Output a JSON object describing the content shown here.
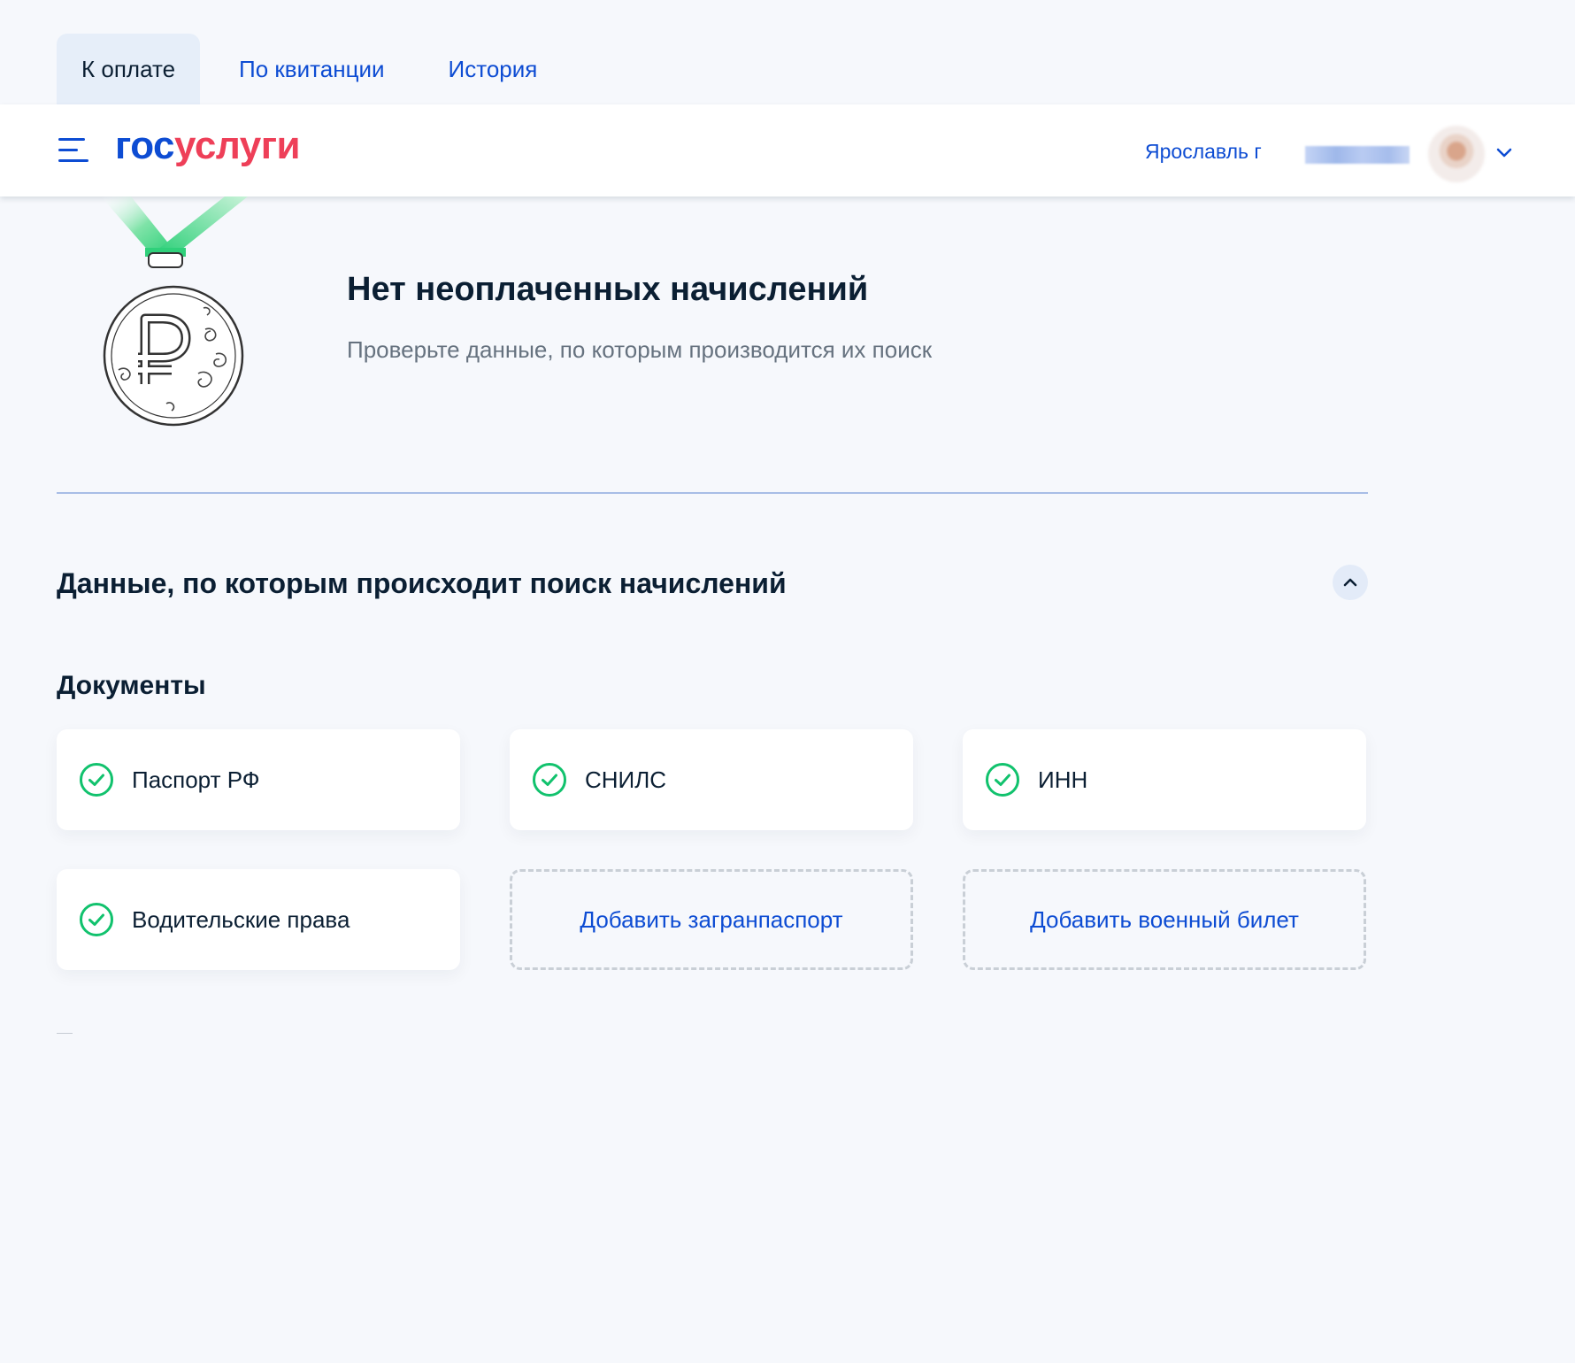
{
  "tabs": [
    {
      "label": "К оплате",
      "active": true
    },
    {
      "label": "По квитанции",
      "active": false
    },
    {
      "label": "История",
      "active": false
    }
  ],
  "header": {
    "logo_part1": "гос",
    "logo_part2": "услуги",
    "city": "Ярославль г",
    "menu_icon": "burger-menu-icon",
    "avatar_chevron_icon": "chevron-down-icon"
  },
  "empty_state": {
    "illustration": "ruble-medal-icon",
    "title": "Нет неоплаченных начислений",
    "subtitle": "Проверьте данные, по которым производится их поиск"
  },
  "search_data": {
    "title": "Данные, по которым происходит поиск начислений",
    "collapse_icon": "chevron-up-icon",
    "documents_title": "Документы",
    "documents": [
      {
        "label": "Паспорт РФ",
        "status": "added"
      },
      {
        "label": "СНИЛС",
        "status": "added"
      },
      {
        "label": "ИНН",
        "status": "added"
      },
      {
        "label": "Водительские права",
        "status": "added"
      }
    ],
    "add_actions": [
      {
        "label": "Добавить загранпаспорт"
      },
      {
        "label": "Добавить военный билет"
      }
    ]
  },
  "colors": {
    "accent_blue": "#0d4cd3",
    "brand_red": "#ee3f58",
    "success_green": "#11c26d",
    "page_bg": "#f6f8fc",
    "text_primary": "#0b1f33",
    "text_secondary": "#66727f"
  }
}
